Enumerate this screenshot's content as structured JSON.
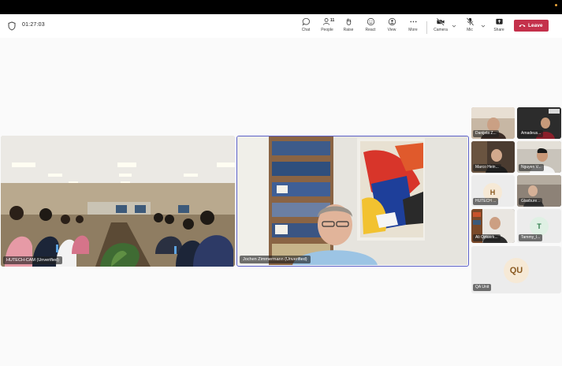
{
  "meeting": {
    "timer": "01:27:03"
  },
  "toolbar": {
    "chat": "Chat",
    "people": "People",
    "people_count": "11",
    "raise": "Raise",
    "react": "React",
    "view": "View",
    "more": "More",
    "camera": "Camera",
    "mic": "Mic",
    "share": "Share",
    "leave": "Leave"
  },
  "main_tiles": [
    {
      "name": "HUTECH-CAM (Unverified)"
    },
    {
      "name": "Jochen Zimmermann (Unverified)"
    }
  ],
  "gallery": [
    {
      "name": "Danijela Z..."
    },
    {
      "name": "Amadeus..."
    },
    {
      "name": "Marco Hein..."
    },
    {
      "name": "Nguyen V..."
    },
    {
      "name": "HUTECH ...",
      "initial": "H"
    },
    {
      "name": "Glasbure..."
    },
    {
      "name": "Ali Oztuerk..."
    },
    {
      "name": "Tammy_I...",
      "initial": "T"
    },
    {
      "name": "QA Unit",
      "initial": "QU"
    }
  ],
  "colors": {
    "accent": "#5b5fc7",
    "leave": "#c4314b"
  }
}
